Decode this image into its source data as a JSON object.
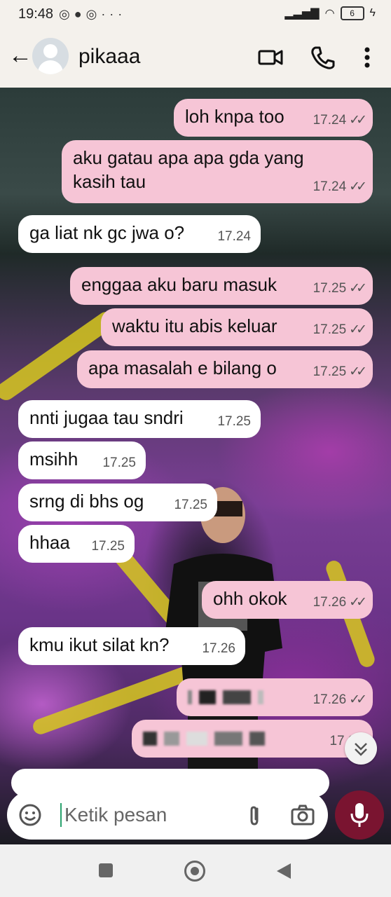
{
  "status": {
    "time": "19:48",
    "icons": [
      "whatsapp-icon",
      "message-icon",
      "whatsapp-icon",
      "more-dots"
    ],
    "battery": "6"
  },
  "header": {
    "contact_name": "pikaaa"
  },
  "messages": [
    {
      "dir": "out",
      "text": "loh knpa too",
      "time": "17.24"
    },
    {
      "dir": "out",
      "text": "aku gatau apa apa gda yang kasih tau",
      "time": "17.24"
    },
    {
      "dir": "in",
      "text": "ga liat nk gc jwa o?",
      "time": "17.24"
    },
    {
      "dir": "out",
      "text": "enggaa aku baru masuk",
      "time": "17.25"
    },
    {
      "dir": "out",
      "text": "waktu itu abis keluar",
      "time": "17.25"
    },
    {
      "dir": "out",
      "text": "apa masalah e bilang o",
      "time": "17.25"
    },
    {
      "dir": "in",
      "text": "nnti jugaa tau sndri",
      "time": "17.25"
    },
    {
      "dir": "in",
      "text": "msihh",
      "time": "17.25"
    },
    {
      "dir": "in",
      "text": "srng di bhs og",
      "time": "17.25"
    },
    {
      "dir": "in",
      "text": "hhaa",
      "time": "17.25"
    },
    {
      "dir": "out",
      "text": "ohh okok",
      "time": "17.26"
    },
    {
      "dir": "in",
      "text": "kmu ikut silat kn?",
      "time": "17.26"
    },
    {
      "dir": "out",
      "text": "",
      "time": "17.26"
    },
    {
      "dir": "out",
      "text": "",
      "time": "17.26"
    }
  ],
  "composer": {
    "placeholder": "Ketik pesan"
  },
  "colors": {
    "outgoing": "#f6c5d6",
    "incoming": "#ffffff",
    "mic": "#7a1430",
    "cursor": "#2aa26e"
  }
}
